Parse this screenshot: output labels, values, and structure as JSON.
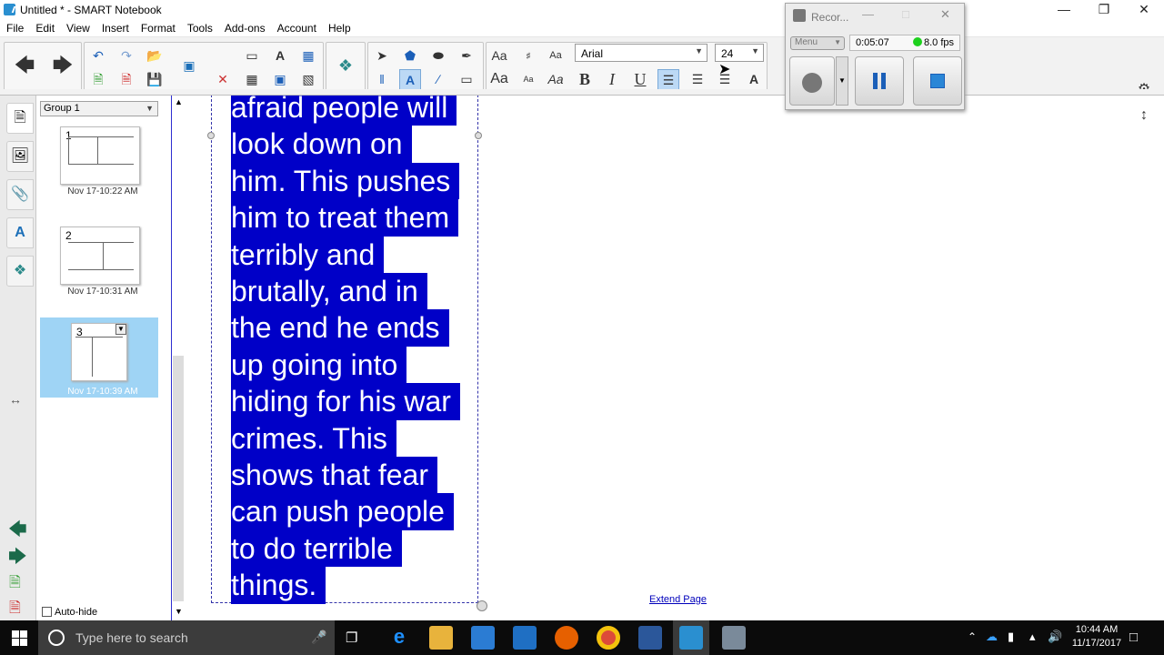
{
  "window": {
    "title": "Untitled * - SMART Notebook"
  },
  "menu": [
    "File",
    "Edit",
    "View",
    "Insert",
    "Format",
    "Tools",
    "Add-ons",
    "Account",
    "Help"
  ],
  "font": {
    "family": "Arial",
    "size": "24"
  },
  "format_labels": {
    "small_aa": "Aa",
    "bold": "B",
    "italic": "I",
    "underline": "U"
  },
  "sorter": {
    "group": "Group 1",
    "pages": [
      {
        "number": "1",
        "date": "Nov 17-10:22 AM"
      },
      {
        "number": "2",
        "date": "Nov 17-10:31 AM"
      },
      {
        "number": "3",
        "date": "Nov 17-10:39 AM"
      }
    ],
    "autohide": "Auto-hide"
  },
  "canvas": {
    "lines": [
      "afraid people will",
      "look down on",
      "him. This pushes",
      "him to treat them",
      "terribly and",
      "brutally, and in",
      "the end he ends",
      "up going into",
      "hiding for his war",
      "crimes. This",
      "shows that fear",
      "can push people",
      "to do terrible",
      "things."
    ],
    "extend_page": "Extend Page"
  },
  "recorder": {
    "title": "Recor...",
    "menu": "Menu",
    "elapsed": "0:05:07",
    "fps": "8.0 fps"
  },
  "taskbar": {
    "search_placeholder": "Type here to search",
    "time": "10:44 AM",
    "date": "11/17/2017"
  },
  "colors": {
    "selection": "#0000c8",
    "accent": "#2a8fd0"
  }
}
